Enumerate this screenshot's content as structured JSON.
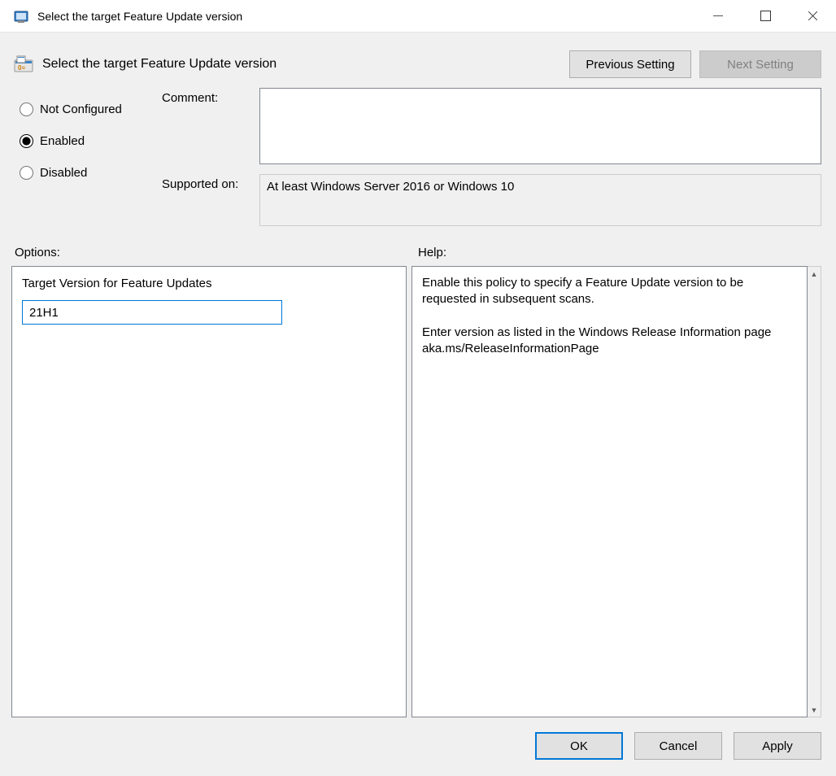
{
  "window": {
    "title": "Select the target Feature Update version"
  },
  "header": {
    "title": "Select the target Feature Update version",
    "prev_label": "Previous Setting",
    "next_label": "Next Setting"
  },
  "state": {
    "radios": {
      "not_configured": "Not Configured",
      "enabled": "Enabled",
      "disabled": "Disabled",
      "selected": "enabled"
    },
    "comment_label": "Comment:",
    "comment_value": "",
    "supported_label": "Supported on:",
    "supported_value": "At least Windows Server 2016 or Windows 10"
  },
  "sections": {
    "options_label": "Options:",
    "help_label": "Help:"
  },
  "options": {
    "target_version_label": "Target Version for Feature Updates",
    "target_version_value": "21H1"
  },
  "help": {
    "text": "Enable this policy to specify a Feature Update version to be requested in subsequent scans.\n\nEnter version as listed in the Windows Release Information page aka.ms/ReleaseInformationPage"
  },
  "footer": {
    "ok": "OK",
    "cancel": "Cancel",
    "apply": "Apply"
  }
}
